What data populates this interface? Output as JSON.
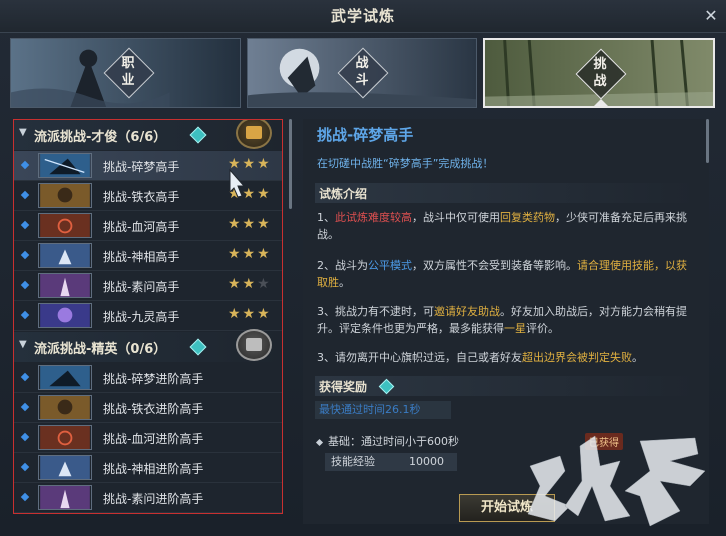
{
  "window": {
    "title": "武学试炼",
    "close": "✕"
  },
  "tabs": [
    {
      "label": "职业",
      "selected": false
    },
    {
      "label": "战斗",
      "selected": false
    },
    {
      "label": "挑战",
      "selected": true
    }
  ],
  "groups": [
    {
      "title": "流派挑战-才俊（6/6）",
      "items": [
        {
          "label": "挑战-碎梦高手",
          "stars": 3,
          "selected": true
        },
        {
          "label": "挑战-铁衣高手",
          "stars": 3
        },
        {
          "label": "挑战-血河高手",
          "stars": 3
        },
        {
          "label": "挑战-神相高手",
          "stars": 3
        },
        {
          "label": "挑战-素问高手",
          "stars": 2
        },
        {
          "label": "挑战-九灵高手",
          "stars": 3
        }
      ]
    },
    {
      "title": "流派挑战-精英（0/6）",
      "items": [
        {
          "label": "挑战-碎梦进阶高手"
        },
        {
          "label": "挑战-铁衣进阶高手"
        },
        {
          "label": "挑战-血河进阶高手"
        },
        {
          "label": "挑战-神相进阶高手"
        },
        {
          "label": "挑战-素问进阶高手"
        }
      ]
    }
  ],
  "detail": {
    "title": "挑战-碎梦高手",
    "desc": "在切磋中战胜“碎梦高手”完成挑战！",
    "intro_header": "试炼介绍",
    "p1": {
      "a": "1、",
      "b": "此试炼难度较高",
      "c": "，战斗中仅可使用",
      "d": "回复类药物",
      "e": "，少侠可准备充足后再来挑战。"
    },
    "p2": {
      "a": "2、战斗为",
      "b": "公平模式",
      "c": "，双方属性不会受到装备等影响。",
      "d": "请合理使用技能，以获取胜",
      "e": "。"
    },
    "p3": {
      "a": "3、挑战力有不逮时，可",
      "b": "邀请好友助战",
      "c": "。好友加入助战后，对方能力会稍有提升。评定条件也更为严格，最多能获得",
      "d": "一星",
      "e": "评价。"
    },
    "p4": {
      "a": "3、请勿离开中心旗帜过远，自己或者好友",
      "b": "超出边界会被判定失败",
      "c": "。"
    },
    "reward_header": "获得奖励",
    "fastest": "最快通过时间26.1秒",
    "base": "基础：通过时间小于600秒",
    "skill_label": "技能经验",
    "skill_value": "10000",
    "obtained": "已获得",
    "start_button": "开始试炼"
  },
  "colors": {
    "accent_blue": "#5ea6e8",
    "highlight_red": "#e05050",
    "highlight_yellow": "#e0b040",
    "star_gold": "#d8b45a"
  }
}
